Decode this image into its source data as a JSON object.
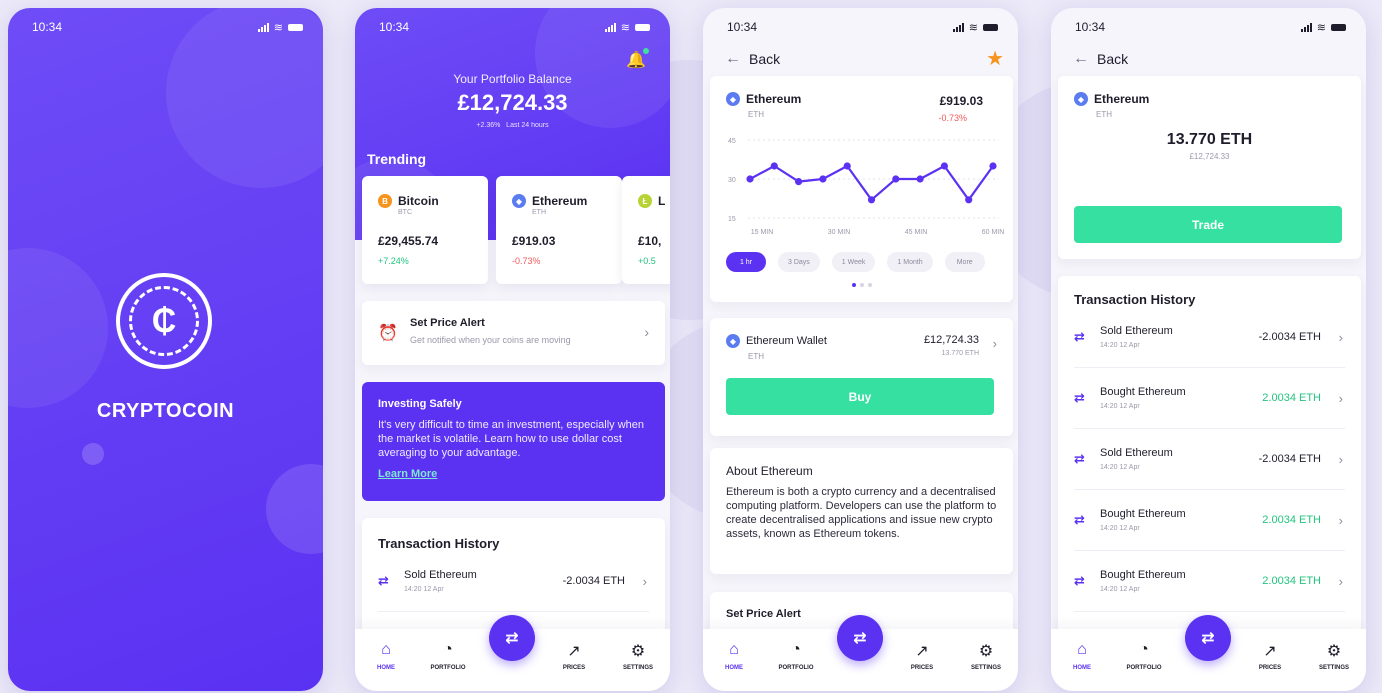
{
  "status": {
    "time": "10:34"
  },
  "splash": {
    "brand": "CRYPTOCOIN",
    "logo_glyph": "₵"
  },
  "home": {
    "portfolio_label": "Your Portfolio Balance",
    "portfolio_value": "£12,724.33",
    "portfolio_change": "+2.36%",
    "portfolio_period": "Last 24 hours",
    "trending_title": "Trending",
    "coins": [
      {
        "name": "Bitcoin",
        "symbol": "BTC",
        "price": "£29,455.74",
        "change": "+7.24%",
        "glyph": "B"
      },
      {
        "name": "Ethereum",
        "symbol": "ETH",
        "price": "£919.03",
        "change": "-0.73%",
        "glyph": "◆"
      },
      {
        "name": "L",
        "symbol": "",
        "price": "£10,",
        "change": "+0.5",
        "glyph": "Ł"
      }
    ],
    "alert": {
      "title": "Set Price Alert",
      "subtitle": "Get notified when your coins are moving"
    },
    "invest": {
      "title": "Investing Safely",
      "body": "It's very difficult to time an investment, especially when the market is volatile. Learn how to use dollar cost averaging to your advantage.",
      "link": "Learn More"
    },
    "history_title": "Transaction History",
    "transactions": [
      {
        "name": "Sold Ethereum",
        "date": "14:20 12 Apr",
        "amount": "-2.0034 ETH"
      }
    ]
  },
  "tabs": {
    "home": "HOME",
    "portfolio": "PORTFOLIO",
    "prices": "PRICES",
    "settings": "SETTINGS"
  },
  "detail": {
    "back": "Back",
    "coin_name": "Ethereum",
    "coin_symbol": "ETH",
    "price": "£919.03",
    "change": "-0.73%",
    "y_ticks": [
      "45",
      "30",
      "15"
    ],
    "x_ticks": [
      "15 MIN",
      "30 MIN",
      "45 MIN",
      "60 MIN"
    ],
    "ranges": [
      "1 hr",
      "3 Days",
      "1 Week",
      "1 Month",
      "More"
    ],
    "wallet": {
      "name": "Ethereum Wallet",
      "symbol": "ETH",
      "value": "£12,724.33",
      "amount": "13.770 ETH"
    },
    "buy": "Buy",
    "about_title": "About Ethereum",
    "about_body": "Ethereum is both a crypto currency and a decentralised computing platform. Developers can use the platform to create decentralised applications and issue new crypto assets, known as Ethereum tokens.",
    "alert_title": "Set Price Alert"
  },
  "chart_data": {
    "type": "line",
    "x": [
      1,
      2,
      3,
      4,
      5,
      6,
      7,
      8,
      9,
      10,
      11
    ],
    "values": [
      30,
      35,
      29,
      30,
      35,
      22,
      30,
      30,
      35,
      22,
      35
    ],
    "ylim": [
      15,
      45
    ],
    "y_ticks": [
      45,
      30,
      15
    ],
    "x_tick_labels": [
      "15 MIN",
      "30 MIN",
      "45 MIN",
      "60 MIN"
    ],
    "color": "#5b32f2"
  },
  "wallet_screen": {
    "back": "Back",
    "coin_name": "Ethereum",
    "coin_symbol": "ETH",
    "balance": "13.770 ETH",
    "balance_fiat": "£12,724.33",
    "trade": "Trade",
    "history_title": "Transaction History",
    "transactions": [
      {
        "name": "Sold Ethereum",
        "date": "14:20 12 Apr",
        "amount": "-2.0034 ETH",
        "type": "sold"
      },
      {
        "name": "Bought Ethereum",
        "date": "14:20 12 Apr",
        "amount": "2.0034 ETH",
        "type": "bought"
      },
      {
        "name": "Sold Ethereum",
        "date": "14:20 12 Apr",
        "amount": "-2.0034 ETH",
        "type": "sold"
      },
      {
        "name": "Bought Ethereum",
        "date": "14:20 12 Apr",
        "amount": "2.0034 ETH",
        "type": "bought"
      },
      {
        "name": "Bought Ethereum",
        "date": "14:20 12 Apr",
        "amount": "2.0034 ETH",
        "type": "bought"
      }
    ]
  },
  "colors": {
    "primary": "#5b32f2",
    "green": "#36e0a0",
    "positive": "#22c47e",
    "negative": "#f05a5a",
    "star": "#f7941d"
  }
}
